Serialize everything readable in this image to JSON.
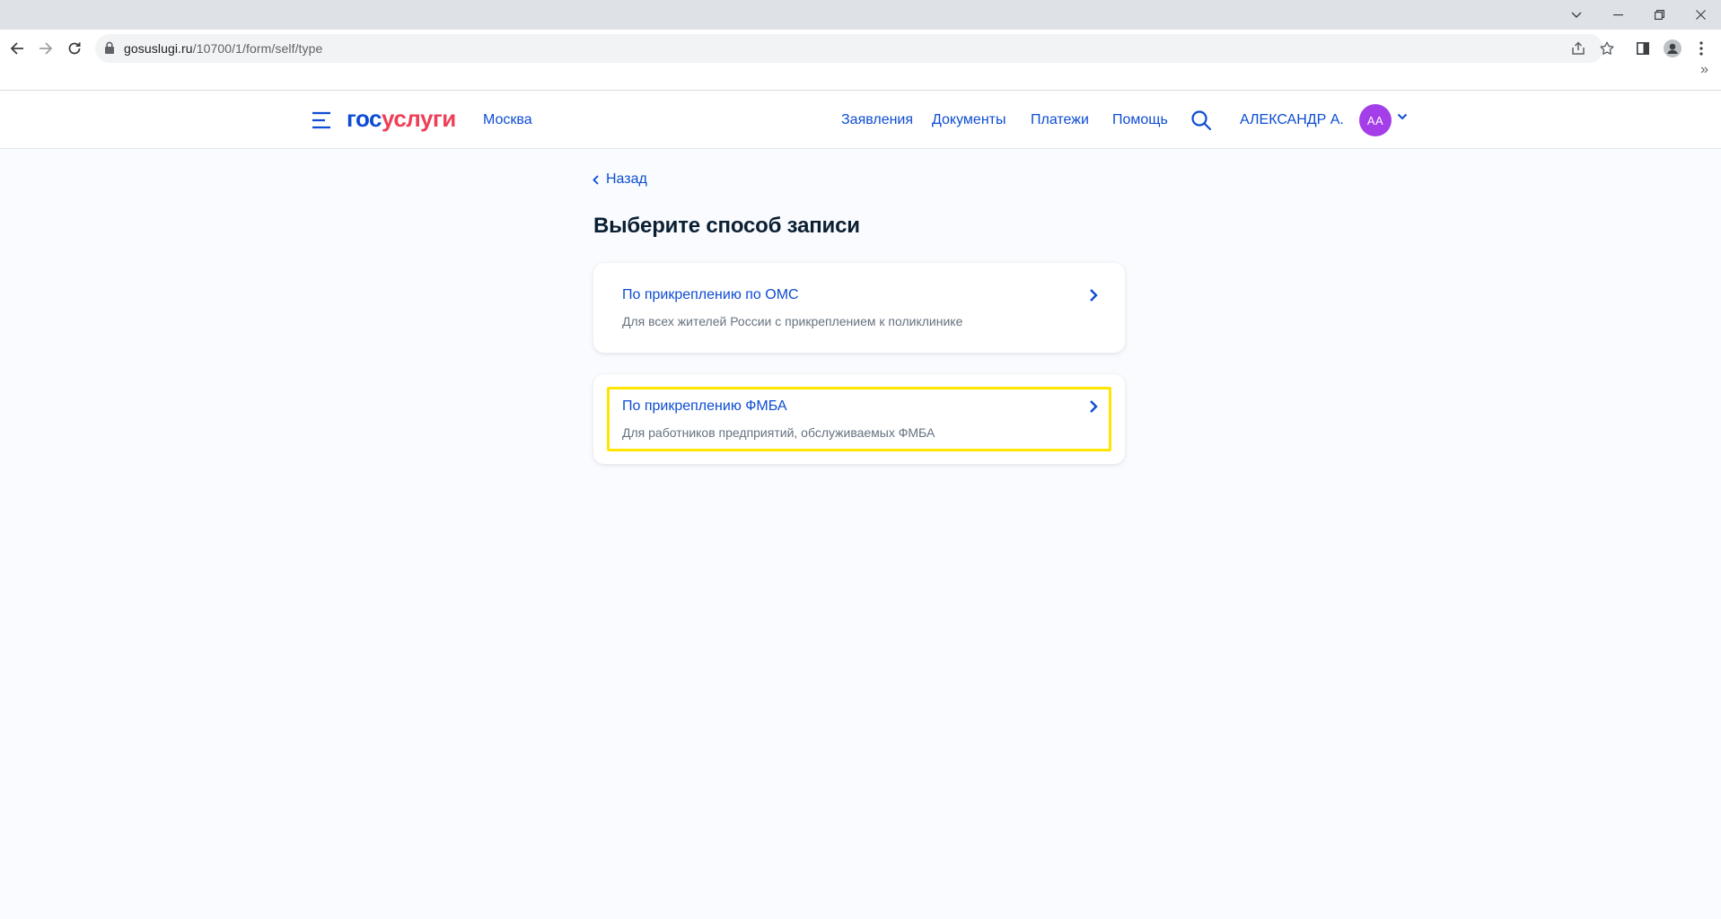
{
  "browser": {
    "url_domain": "gosuslugi.ru",
    "url_path": "/10700/1/form/self/type",
    "bookmarks_overflow": "»"
  },
  "header": {
    "logo_gos": "гос",
    "logo_uslugi": "услуги",
    "city": "Москва",
    "nav": [
      "Заявления",
      "Документы",
      "Платежи",
      "Помощь"
    ],
    "user_name": "АЛЕКСАНДР А.",
    "avatar_initials": "АА"
  },
  "main": {
    "back_label": "Назад",
    "title": "Выберите способ записи",
    "options": [
      {
        "title": "По прикреплению по ОМС",
        "description": "Для всех жителей России с прикреплением к поликлинике"
      },
      {
        "title": "По прикреплению ФМБА",
        "description": "Для работников предприятий, обслуживаемых ФМБА"
      }
    ]
  },
  "colors": {
    "brand_blue": "#0d4cd3",
    "brand_red": "#ee3f58",
    "avatar": "#a43ee8",
    "highlight": "#ffe600"
  },
  "icons": [
    "chevron-down-icon",
    "minimize-icon",
    "restore-icon",
    "close-icon",
    "back-arrow-icon",
    "forward-arrow-icon",
    "reload-icon",
    "lock-icon",
    "share-icon",
    "star-icon",
    "sidepanel-icon",
    "profile-icon",
    "kebab-menu-icon",
    "burger-menu-icon",
    "search-icon",
    "chevron-left-icon",
    "chevron-right-icon"
  ]
}
